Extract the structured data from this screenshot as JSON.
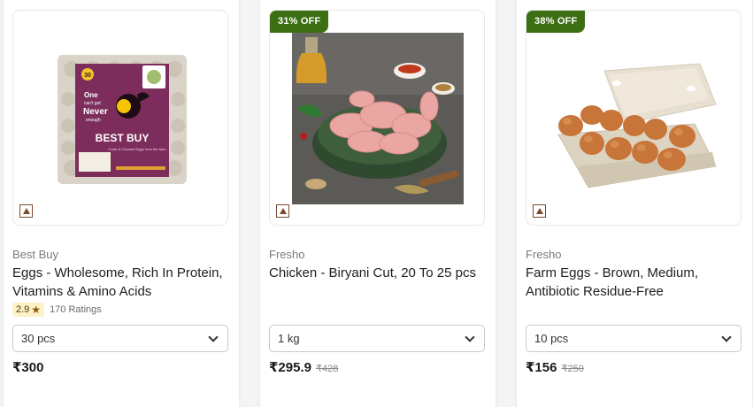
{
  "products": [
    {
      "brand": "Best Buy",
      "title": "Eggs - Wholesome, Rich In Protein, Vitamins & Amino Acids",
      "discount": "",
      "rating": "2.9",
      "ratings_count": "170 Ratings",
      "pack_size": "30 pcs",
      "price": "₹300",
      "mrp": "",
      "package_text": {
        "count": "30",
        "tagline_1": "One",
        "tagline_2": "can't get",
        "tagline_3": "Never",
        "tagline_4": "enough",
        "name": "BEST BUY",
        "sub": "Fresh & Cleaned Eggs from the farm"
      }
    },
    {
      "brand": "Fresho",
      "title": "Chicken - Biryani Cut, 20 To 25 pcs",
      "discount": "31% OFF",
      "rating": "",
      "ratings_count": "",
      "pack_size": "1 kg",
      "price": "₹295.9",
      "mrp": "₹428"
    },
    {
      "brand": "Fresho",
      "title": "Farm Eggs - Brown, Medium, Antibiotic Residue-Free",
      "discount": "38% OFF",
      "rating": "",
      "ratings_count": "",
      "pack_size": "10 pcs",
      "price": "₹156",
      "mrp": "₹250"
    }
  ],
  "colors": {
    "badge": "#3c6e13",
    "veg_icon": "#7a4a2b",
    "rating_bg": "#fdf1c8"
  }
}
